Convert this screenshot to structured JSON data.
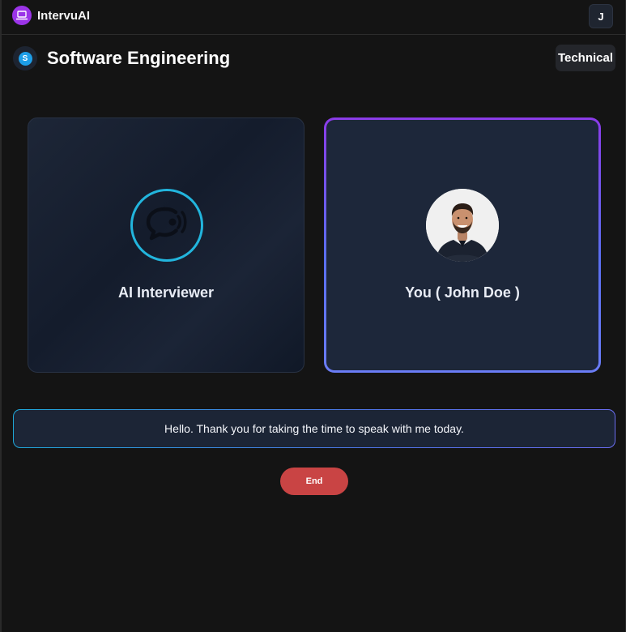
{
  "app": {
    "name": "IntervuAI",
    "logo_icon": "laptop-icon",
    "brand_color": "#9b34e8"
  },
  "user": {
    "avatar_initial": "J"
  },
  "interview": {
    "logo_icon": "skype-icon",
    "logo_letter": "S",
    "title": "Software Engineering",
    "type": "Technical"
  },
  "cards": {
    "ai": {
      "label": "AI Interviewer",
      "icon": "chat-speaking-icon",
      "ring_color": "#22b5dd"
    },
    "user": {
      "label": "You ( John Doe )",
      "avatar": "user-profile-photo"
    }
  },
  "transcript": {
    "text": "Hello. Thank you for taking the time to speak with me today."
  },
  "controls": {
    "end_label": "End",
    "end_color": "#c94444"
  }
}
